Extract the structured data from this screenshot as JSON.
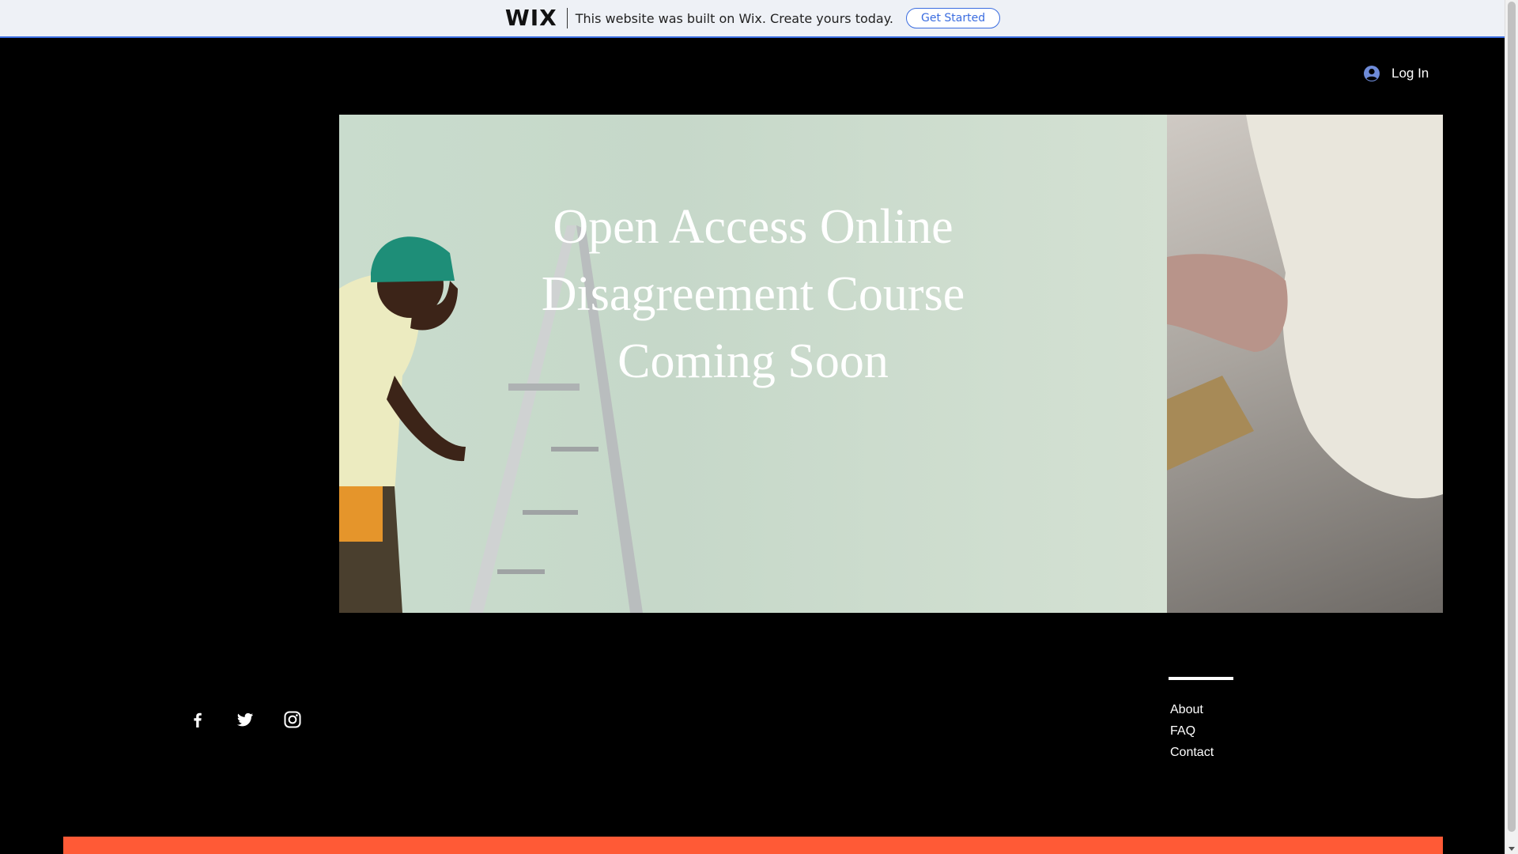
{
  "wix_banner": {
    "logo": "WIX",
    "message": "This website was built on Wix. Create yours today.",
    "cta_label": "Get Started",
    "accent_color": "#3b6de0"
  },
  "header": {
    "login_label": "Log In",
    "login_icon": "user-avatar-icon"
  },
  "hero": {
    "title_lines": [
      "Open Access Online",
      "Disagreement Course",
      "Coming Soon"
    ]
  },
  "social": {
    "icons": [
      "facebook-icon",
      "twitter-icon",
      "instagram-icon"
    ]
  },
  "footer_nav": {
    "items": [
      "About",
      "FAQ",
      "Contact"
    ]
  },
  "colors": {
    "background": "#000000",
    "strip": "#ff5a36"
  }
}
